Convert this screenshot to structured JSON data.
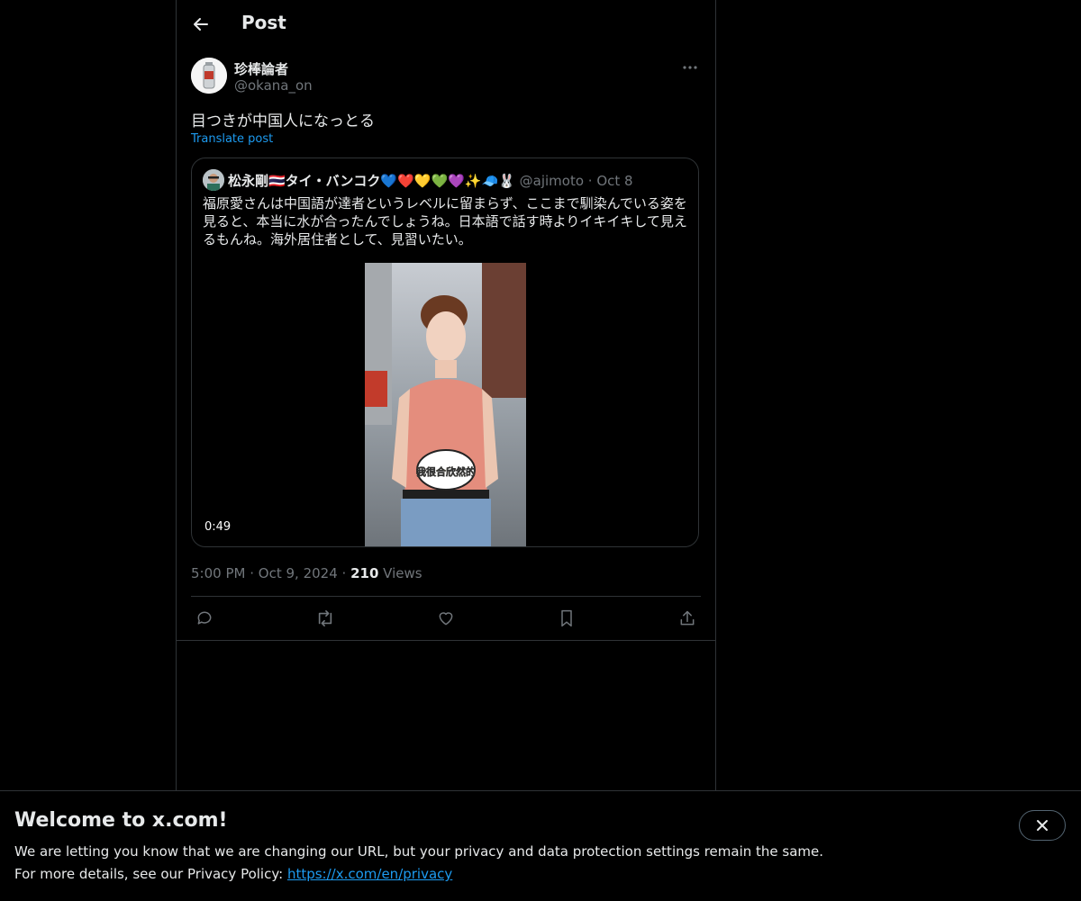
{
  "header": {
    "title": "Post"
  },
  "post": {
    "display_name": "珍棒論者",
    "handle": "@okana_on",
    "text": "目つきが中国人になっとる",
    "translate_label": "Translate post",
    "time": "5:00 PM",
    "date": "Oct 9, 2024",
    "views_count": "210",
    "views_label": "Views"
  },
  "quote": {
    "display_name": "松永剛🇹🇭タイ・バンコク💙❤️💛💚💜✨🧢🐰",
    "handle": "@ajimoto",
    "date": "Oct 8",
    "text": "福原愛さんは中国語が達者というレベルに留まらず、ここまで馴染んでいる姿を見ると、本当に水が合ったんでしょうね。日本語で話す時よりイキイキして見えるもんね。海外居住者として、見習いたい。",
    "video_duration": "0:49"
  },
  "actions": {
    "icons": [
      "reply-icon",
      "repost-icon",
      "like-icon",
      "bookmark-icon",
      "share-icon"
    ]
  },
  "banner": {
    "title": "Welcome to x.com!",
    "line1": "We are letting you know that we are changing our URL, but your privacy and data protection settings remain the same.",
    "line2_prefix": "For more details, see our Privacy Policy: ",
    "link": "https://x.com/en/privacy"
  },
  "colors": {
    "background": "#000000",
    "text": "#e7e9ea",
    "secondary": "#71767b",
    "accent": "#1d9bf0",
    "border": "#2f3336"
  }
}
